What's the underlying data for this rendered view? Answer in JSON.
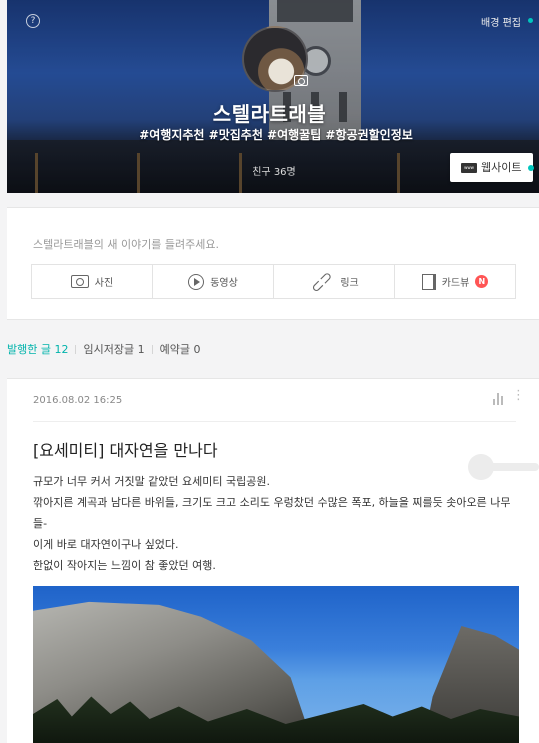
{
  "header": {
    "help_icon": "?",
    "edit_background": "배경 편집",
    "blog_name": "스텔라트래블",
    "hashtags": "#여행지추천 #맛집추천 #여행꿀팁 #항공권할인정보",
    "friends": "친구 36명",
    "website_label": "웹사이트",
    "website_icon_text": "www"
  },
  "composer": {
    "prompt": "스텔라트래블의 새 이야기를 들려주세요.",
    "actions": [
      {
        "label": "사진",
        "icon": "camera-icon"
      },
      {
        "label": "동영상",
        "icon": "play-icon"
      },
      {
        "label": "링크",
        "icon": "link-icon"
      },
      {
        "label": "카드뷰",
        "icon": "card-view-icon",
        "badge": "N"
      }
    ]
  },
  "tabs": [
    {
      "label": "발행한 글 12",
      "active": true
    },
    {
      "label": "임시저장글 1",
      "active": false
    },
    {
      "label": "예약글 0",
      "active": false
    }
  ],
  "post": {
    "date": "2016.08.02 16:25",
    "title": "[요세미티] 대자연을 만나다",
    "body": [
      "규모가 너무 커서 거짓말 같았던 요세미티 국립공원.",
      "깎아지른 계곡과 남다른 바위들, 크기도 크고 소리도 우렁찼던 수많은 폭포, 하늘을 찌를듯 솟아오른 나무들-",
      "이게 바로 대자연이구나 싶었다.",
      "한없이 작아지는 느낌이 참 좋았던 여행."
    ],
    "more_icon": "⋮"
  },
  "colors": {
    "accent": "#00b3ab",
    "badge": "#ff5555"
  }
}
